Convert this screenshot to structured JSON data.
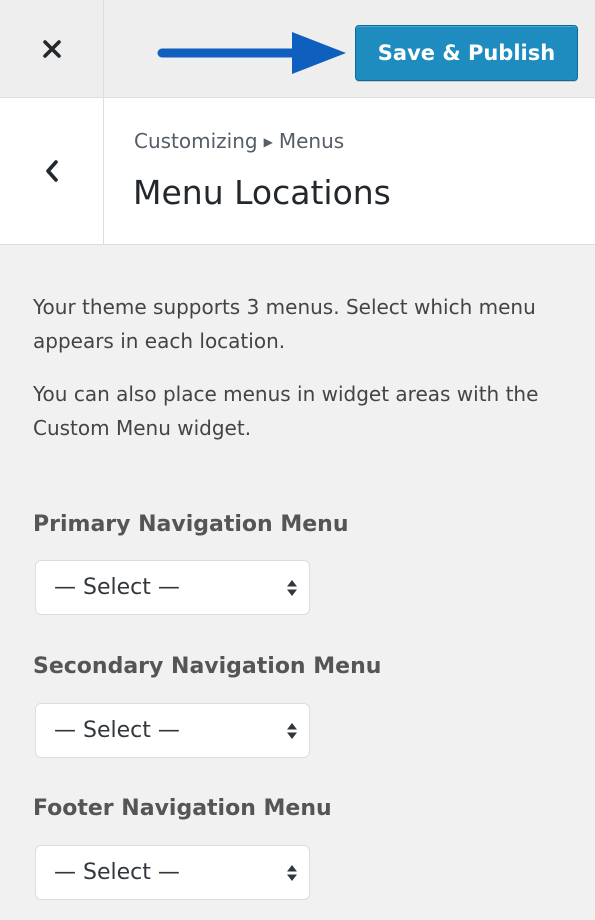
{
  "topbar": {
    "close_icon": "close-icon",
    "arrow_icon": "arrow-right-icon",
    "arrow_color": "#0f5fbf",
    "publish_label": "Save & Publish",
    "publish_color": "#1e8cbe"
  },
  "section": {
    "back_icon": "chevron-left-icon",
    "breadcrumb_parent": "Customizing",
    "breadcrumb_separator_icon": "caret-right-icon",
    "breadcrumb_current": "Menus",
    "title": "Menu Locations"
  },
  "content": {
    "description_1": "Your theme supports 3 menus. Select which menu appears in each location.",
    "description_2": "You can also place menus in widget areas with the Custom Menu widget.",
    "locations": [
      {
        "label": "Primary Navigation Menu",
        "selected": "— Select —"
      },
      {
        "label": "Secondary Navigation Menu",
        "selected": "— Select —"
      },
      {
        "label": "Footer Navigation Menu",
        "selected": "— Select —"
      }
    ]
  }
}
